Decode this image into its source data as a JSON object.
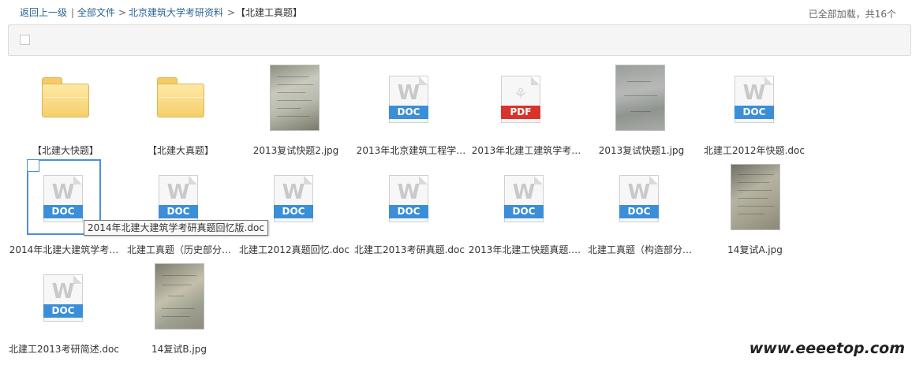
{
  "breadcrumb": {
    "back": "返回上一级",
    "divider": "|",
    "items": [
      "全部文件",
      "北京建筑大学考研资料",
      "【北建工真题】"
    ],
    "sep": ">"
  },
  "status": "已全部加载，共16个",
  "tooltip": "2014年北建大建筑学考研真题回忆版.doc",
  "files": [
    {
      "name": "【北建大快题】",
      "type": "folder"
    },
    {
      "name": "【北建大真题】",
      "type": "folder"
    },
    {
      "name": "2013复试快题2.jpg",
      "type": "jpg"
    },
    {
      "name": "2013年北京建筑工程学…",
      "type": "doc",
      "badge": "DOC"
    },
    {
      "name": "2013年北建工建筑学考…",
      "type": "pdf",
      "badge": "PDF"
    },
    {
      "name": "2013复试快题1.jpg",
      "type": "jpg"
    },
    {
      "name": "北建工2012年快题.doc",
      "type": "doc",
      "badge": "DOC"
    },
    {
      "name": "2014年北建大建筑学考…",
      "type": "doc",
      "badge": "DOC"
    },
    {
      "name": "北建工真题（历史部分…",
      "type": "doc",
      "badge": "DOC"
    },
    {
      "name": "北建工2012真题回忆.doc",
      "type": "doc",
      "badge": "DOC"
    },
    {
      "name": "北建工2013考研真题.doc",
      "type": "doc",
      "badge": "DOC"
    },
    {
      "name": "2013年北建工快题真题.…",
      "type": "doc",
      "badge": "DOC"
    },
    {
      "name": "北建工真题（构造部分…",
      "type": "doc",
      "badge": "DOC"
    },
    {
      "name": "14复试A.jpg",
      "type": "jpg"
    },
    {
      "name": "北建工2013考研简述.doc",
      "type": "doc",
      "badge": "DOC"
    },
    {
      "name": "14复试B.jpg",
      "type": "jpg"
    }
  ],
  "icons": {
    "doc_letter": "W",
    "pdf_glyph": "⚘"
  },
  "watermark": "www.eeeetop.com",
  "colors": {
    "link": "#2a6496",
    "doc_band": "#3b8ed8",
    "pdf_band": "#d9342b",
    "selection": "#4a8fdb"
  }
}
